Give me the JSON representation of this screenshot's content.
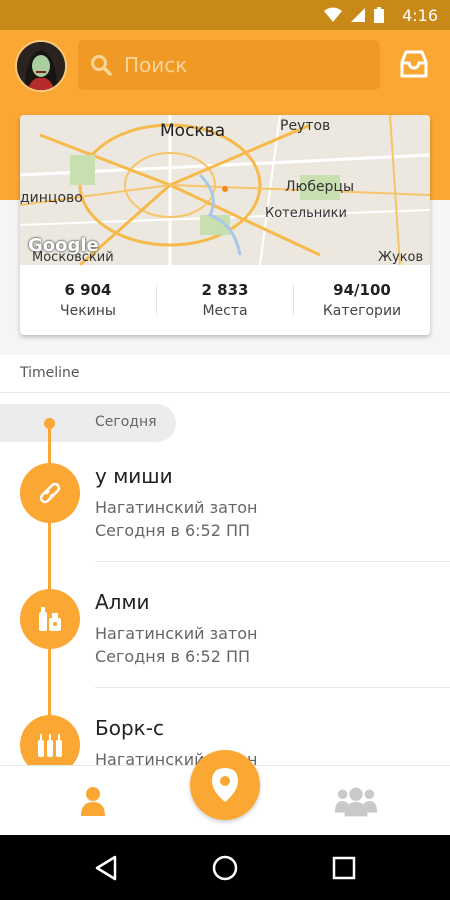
{
  "status_bar": {
    "time": "4:16"
  },
  "search": {
    "placeholder": "Поиск"
  },
  "map": {
    "labels": {
      "moskva": "Москва",
      "reutov": "Реутов",
      "lyubertsy": "Люберцы",
      "kotelniki": "Котельники",
      "odintsovo": "динцово",
      "moskovsky": "Московский",
      "zhukov": "Жуков",
      "google": "Google"
    }
  },
  "stats": [
    {
      "value": "6 904",
      "label": "Чекины"
    },
    {
      "value": "2 833",
      "label": "Места"
    },
    {
      "value": "94/100",
      "label": "Категории"
    }
  ],
  "timeline": {
    "header": "Timeline",
    "today": "Сегодня",
    "items": [
      {
        "title": "у миши",
        "place": "Нагатинский затон",
        "time": "Сегодня в 6:52 ПП",
        "icon": "bread-icon"
      },
      {
        "title": "Алми",
        "place": "Нагатинский затон",
        "time": "Сегодня в 6:52 ПП",
        "icon": "grocery-icon"
      },
      {
        "title": "Борк-с",
        "place": "Нагатинский затон",
        "time": "",
        "icon": "bottles-icon"
      }
    ]
  },
  "colors": {
    "accent": "#fba734",
    "accent_dark": "#c98916"
  }
}
